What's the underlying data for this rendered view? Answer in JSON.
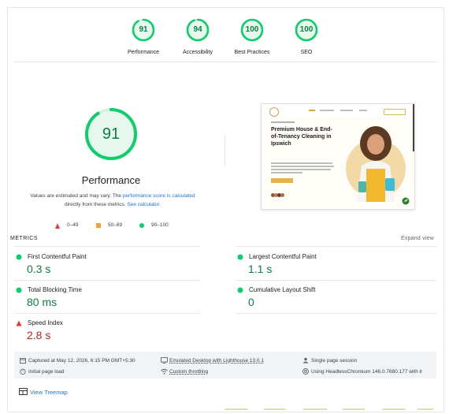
{
  "colors": {
    "pass_green": "#0cce6b",
    "pass_text": "#0b8043",
    "fail_red": "#c5221f",
    "average_orange": "#fa9e36",
    "link_blue": "#1a73e8"
  },
  "categories": [
    {
      "score": "91",
      "label": "Performance",
      "fraction": 0.91
    },
    {
      "score": "94",
      "label": "Accessibility",
      "fraction": 0.94
    },
    {
      "score": "100",
      "label": "Best Practices",
      "fraction": 1.0
    },
    {
      "score": "100",
      "label": "SEO",
      "fraction": 1.0
    }
  ],
  "main_gauge": {
    "score": "91",
    "fraction": 0.91,
    "title": "Performance"
  },
  "description": {
    "prefix": "Values are estimated and may vary. The ",
    "link1": "performance score is calculated",
    "middle": " directly from these metrics. ",
    "link2": "See calculator",
    "suffix": "."
  },
  "legend": {
    "fail": "0–49",
    "average": "50–89",
    "pass": "90–100"
  },
  "thumbnail": {
    "heading": "Premium House & End-of-Tenancy Cleaning in Ipswich"
  },
  "metrics_section": {
    "title": "METRICS",
    "expand": "Expand view"
  },
  "metrics": [
    {
      "label": "First Contentful Paint",
      "value": "0.3 s",
      "status": "pass"
    },
    {
      "label": "Largest Contentful Paint",
      "value": "1.1 s",
      "status": "pass"
    },
    {
      "label": "Total Blocking Time",
      "value": "80 ms",
      "status": "pass"
    },
    {
      "label": "Cumulative Layout Shift",
      "value": "0",
      "status": "pass"
    },
    {
      "label": "Speed Index",
      "value": "2.8 s",
      "status": "fail"
    }
  ],
  "info": {
    "captured": "Captured at May 12, 2026, 6:15 PM GMT+5:30",
    "emulated": "Emulated Desktop with Lighthouse 13.0.1",
    "session": "Single page session",
    "load": "Initial page load",
    "throttling": "Custom throttling",
    "browser": "Using HeadlessChromium 146.0.7680.177 with lr"
  },
  "treemap": "View Treemap",
  "icons": {
    "calendar": "calendar-icon",
    "monitor": "monitor-icon",
    "user": "user-icon",
    "stopwatch": "stopwatch-icon",
    "wifi": "wifi-icon",
    "chromium": "chromium-icon",
    "treemap": "treemap-icon"
  }
}
